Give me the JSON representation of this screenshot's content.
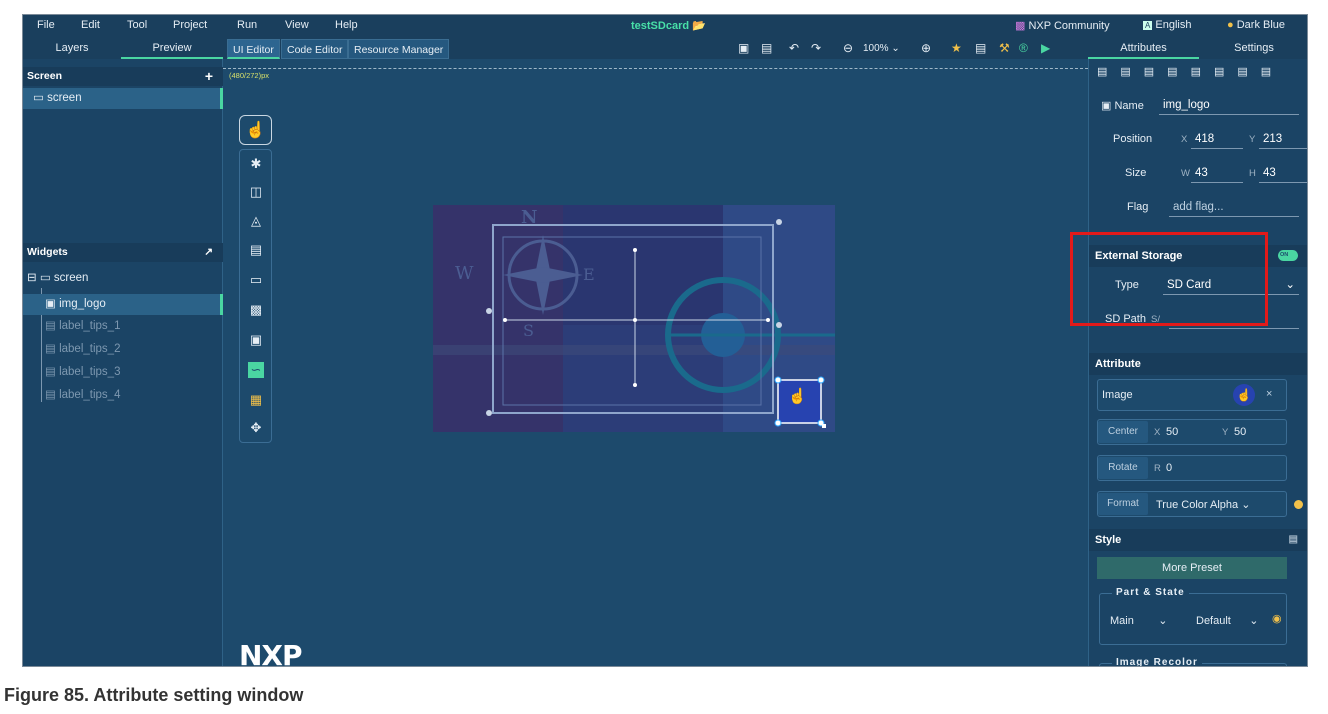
{
  "menu": {
    "items": [
      "File",
      "Edit",
      "Tool",
      "Project",
      "Run",
      "View",
      "Help"
    ],
    "title": "testSDcard",
    "community": "NXP Community",
    "language": "English",
    "theme": "Dark Blue"
  },
  "left_tabs": {
    "layers": "Layers",
    "preview": "Preview"
  },
  "editor_tabs": [
    "UI Editor",
    "Code Editor",
    "Resource Manager"
  ],
  "zoom": "100%",
  "right_tabs": {
    "attributes": "Attributes",
    "settings": "Settings"
  },
  "screen_panel": {
    "title": "Screen",
    "add": "+",
    "items": [
      "screen"
    ]
  },
  "widgets_panel": {
    "title": "Widgets",
    "items": [
      "screen",
      "img_logo",
      "label_tips_1",
      "label_tips_2",
      "label_tips_3",
      "label_tips_4"
    ]
  },
  "canvas": {
    "resolution": "(480/272)px",
    "logo": "NXP",
    "compass": {
      "n": "N",
      "w": "W",
      "e": "E",
      "s": "S"
    }
  },
  "props": {
    "name_label": "Name",
    "name_value": "img_logo",
    "position_label": "Position",
    "x_label": "X",
    "x": "418",
    "y_label": "Y",
    "y": "213",
    "size_label": "Size",
    "w_label": "W",
    "w": "43",
    "h_label": "H",
    "h": "43",
    "flag_label": "Flag",
    "flag_placeholder": "add flag..."
  },
  "external_storage": {
    "title": "External Storage",
    "toggle": "ON",
    "type_label": "Type",
    "type_value": "SD Card",
    "path_label": "SD Path",
    "path_value": "S/"
  },
  "attribute": {
    "title": "Attribute",
    "image_label": "Image",
    "center_label": "Center",
    "cx_label": "X",
    "cx": "50",
    "cy_label": "Y",
    "cy": "50",
    "rotate_label": "Rotate",
    "r_label": "R",
    "r": "0",
    "format_label": "Format",
    "format_value": "True Color Alpha"
  },
  "style": {
    "title": "Style",
    "more_preset": "More Preset",
    "part_state": "Part & State",
    "part": "Main",
    "state": "Default",
    "recolor": "Image Recolor"
  },
  "caption": "Figure 85.  Attribute setting window",
  "colors": {
    "accent": "#4ad6a2",
    "highlight": "#e21a1a",
    "background": "#1d4a6c"
  }
}
